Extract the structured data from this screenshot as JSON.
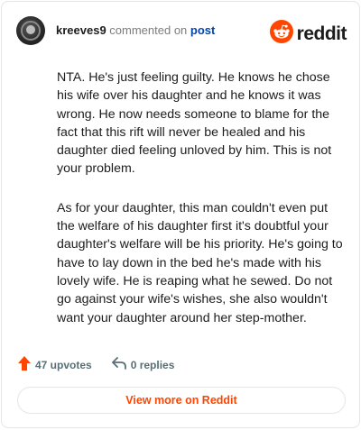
{
  "header": {
    "username": "kreeves9",
    "action_text": "commented on",
    "post_link": "post"
  },
  "logo": {
    "wordmark": "reddit",
    "icon": "reddit-snoo-icon",
    "brand_color": "#ff4500"
  },
  "comment": {
    "paragraphs": [
      "NTA. He's just feeling guilty. He knows he chose his wife over his daughter and he knows it was wrong. He now needs someone to blame for the fact that this rift will never be healed and his daughter died feeling unloved by him. This is not your problem.",
      "As for your daughter, this man couldn't even put the welfare of his daughter first it's doubtful your daughter's welfare will be his priority. He's going to have to lay down in the bed he's made with his lovely wife. He is reaping what he sewed. Do not go against your wife's wishes, she also wouldn't want your daughter around her step-mother."
    ]
  },
  "actions": {
    "upvotes_label": "47 upvotes",
    "upvote_icon": "upvote-arrow-icon",
    "upvote_color": "#ff4500",
    "replies_label": "0 replies",
    "reply_icon": "reply-arrow-icon"
  },
  "footer": {
    "view_more_label": "View more on Reddit"
  }
}
